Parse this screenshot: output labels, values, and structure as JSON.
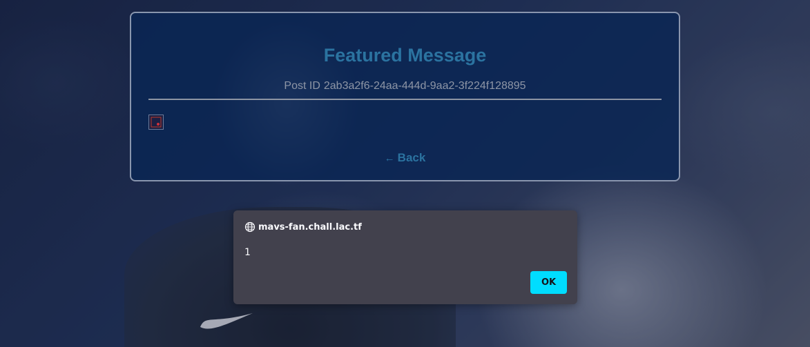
{
  "card": {
    "title": "Featured Message",
    "post_id_label": "Post ID",
    "post_id_value": "2ab3a2f6-24aa-444d-9aa2-3f224f128895",
    "back_arrow": "←",
    "back_label": "Back"
  },
  "dialog": {
    "origin": "mavs-fan.chall.lac.tf",
    "message": "1",
    "ok_label": "OK"
  },
  "colors": {
    "accent": "#2b73a0",
    "dialog_bg": "#42414d",
    "ok_button": "#00ddff"
  },
  "icons": {
    "dialog_origin": "globe-icon",
    "broken_image": "broken-image-icon",
    "background_logo": "nike-swoosh-icon"
  }
}
